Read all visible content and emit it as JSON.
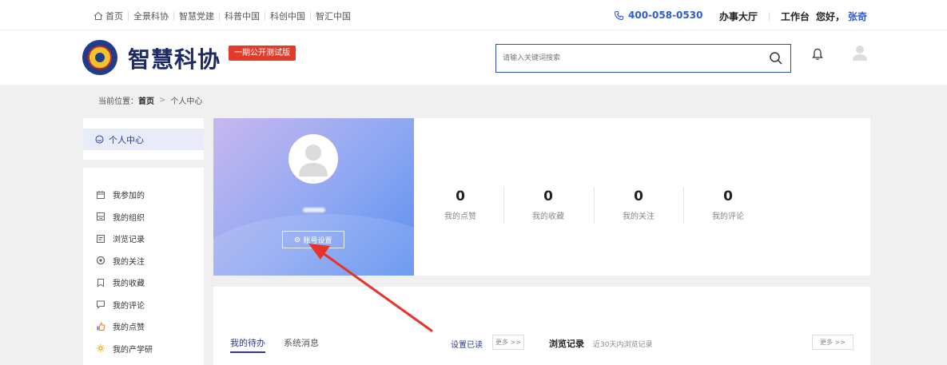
{
  "topbar": {
    "nav": [
      "首页",
      "全景科协",
      "智慧党建",
      "科普中国",
      "科创中国",
      "智汇中国"
    ],
    "phone": "400-058-0530",
    "service_hall": "办事大厅",
    "workbench": "工作台",
    "greeting": "您好，",
    "username": "张奇"
  },
  "header": {
    "site_title": "智慧科协",
    "beta_tag": "一期公开测试版",
    "search_placeholder": "请输入关键词搜索"
  },
  "breadcrumb": {
    "prefix": "当前位置：",
    "home": "首页",
    "separator": ">",
    "current": "个人中心"
  },
  "sidebar": {
    "active": "个人中心",
    "items": [
      {
        "label": "我参加的",
        "icon": "calendar-icon"
      },
      {
        "label": "我的组织",
        "icon": "organization-icon"
      },
      {
        "label": "浏览记录",
        "icon": "history-icon"
      },
      {
        "label": "我的关注",
        "icon": "follow-icon"
      },
      {
        "label": "我的收藏",
        "icon": "bookmark-icon"
      },
      {
        "label": "我的评论",
        "icon": "comment-icon"
      },
      {
        "label": "我的点赞",
        "icon": "thumbs-up-icon"
      },
      {
        "label": "我的产学研",
        "icon": "gear-icon"
      }
    ]
  },
  "profile": {
    "account_settings": "账号设置"
  },
  "stats": [
    {
      "value": "0",
      "label": "我的点赞"
    },
    {
      "value": "0",
      "label": "我的收藏"
    },
    {
      "value": "0",
      "label": "我的关注"
    },
    {
      "value": "0",
      "label": "我的评论"
    }
  ],
  "bottom": {
    "tab_todo": "我的待办",
    "tab_messages": "系统消息",
    "set_read": "设置已读",
    "more": "更多 >>",
    "browse_title": "浏览记录",
    "browse_subtitle": "近30天内浏览记录",
    "more2": "更多 >>"
  },
  "colors": {
    "accent": "#2d3a8c",
    "link": "#2d5bd3",
    "beta": "#e23b2b",
    "annotation": "#e8322a"
  }
}
